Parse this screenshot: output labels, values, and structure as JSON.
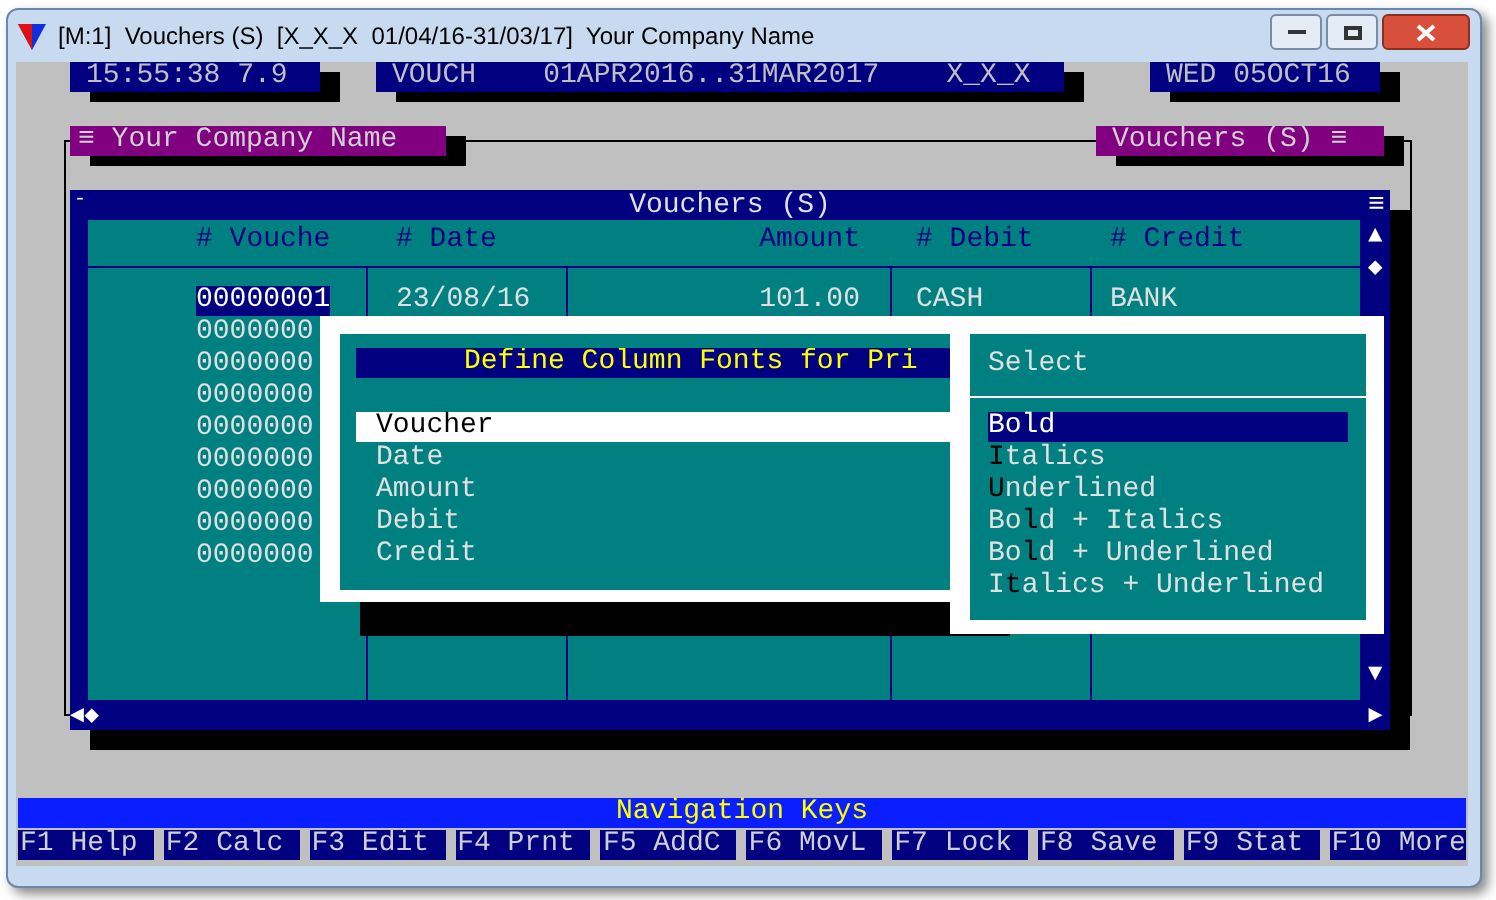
{
  "window": {
    "title": "[M:1]  Vouchers (S)  [X_X_X  01/04/16-31/03/17]  Your Company Name"
  },
  "info_boxes": [
    {
      "text": "15:55:38 7.9"
    },
    {
      "text": "VOUCH    01APR2016..31MAR2017    X_X_X"
    },
    {
      "text": "WED 05OCT16"
    }
  ],
  "frame_titles": [
    {
      "text": "≡ Your Company Name"
    },
    {
      "text": "Vouchers (S) ≡"
    }
  ],
  "vouchers": {
    "title": "Vouchers (S)",
    "corner_glyph": "-",
    "menu_glyph": "≡",
    "scroll": {
      "up": "▲",
      "thumb": "◆",
      "down": "▼",
      "left": "◄◆",
      "right": "►"
    },
    "columns": [
      "# Vouche",
      "# Date",
      "Amount",
      "# Debit",
      "# Credit"
    ],
    "rows": [
      {
        "cells": [
          "00000001",
          "23/08/16",
          "101.00",
          "CASH",
          "BANK"
        ],
        "selected": true
      },
      {
        "cells": [
          "0000000"
        ],
        "selected": false
      },
      {
        "cells": [
          "0000000"
        ],
        "selected": false
      },
      {
        "cells": [
          "0000000"
        ],
        "selected": false
      },
      {
        "cells": [
          "0000000"
        ],
        "selected": false
      },
      {
        "cells": [
          "0000000"
        ],
        "selected": false
      },
      {
        "cells": [
          "0000000"
        ],
        "selected": false
      },
      {
        "cells": [
          "0000000"
        ],
        "selected": false
      },
      {
        "cells": [
          "0000000"
        ],
        "selected": false
      }
    ]
  },
  "dialog": {
    "title": "Define Column Fonts for Pri",
    "items": [
      {
        "label": "Voucher",
        "selected": true
      },
      {
        "label": "Date",
        "selected": false
      },
      {
        "label": "Amount",
        "selected": false
      },
      {
        "label": "Debit",
        "selected": false
      },
      {
        "label": "Credit",
        "selected": false
      }
    ]
  },
  "select": {
    "title": "Select",
    "options": [
      {
        "pre": "Bold",
        "selected": true
      },
      {
        "key": "I",
        "post": "talics",
        "selected": false
      },
      {
        "key": "U",
        "post": "nderlined",
        "selected": false
      },
      {
        "pre": "Bo",
        "key": "l",
        "post": "d + Italics",
        "selected": false
      },
      {
        "pre": "Bo",
        "key": "l",
        "post": "d + Underlined",
        "selected": false
      },
      {
        "pre": "I",
        "key": "t",
        "post": "alics + Underlined",
        "selected": false
      }
    ]
  },
  "navigation": {
    "title": "Navigation Keys",
    "keys": [
      {
        "label": "F1 Help"
      },
      {
        "label": "F2 Calc"
      },
      {
        "label": "F3 Edit"
      },
      {
        "label": "F4 Prnt"
      },
      {
        "label": "F5 AddC"
      },
      {
        "label": "F6 MovL"
      },
      {
        "label": "F7 Lock"
      },
      {
        "label": "F8 Save"
      },
      {
        "label": "F9 Stat"
      },
      {
        "label": "F10 More"
      }
    ]
  }
}
